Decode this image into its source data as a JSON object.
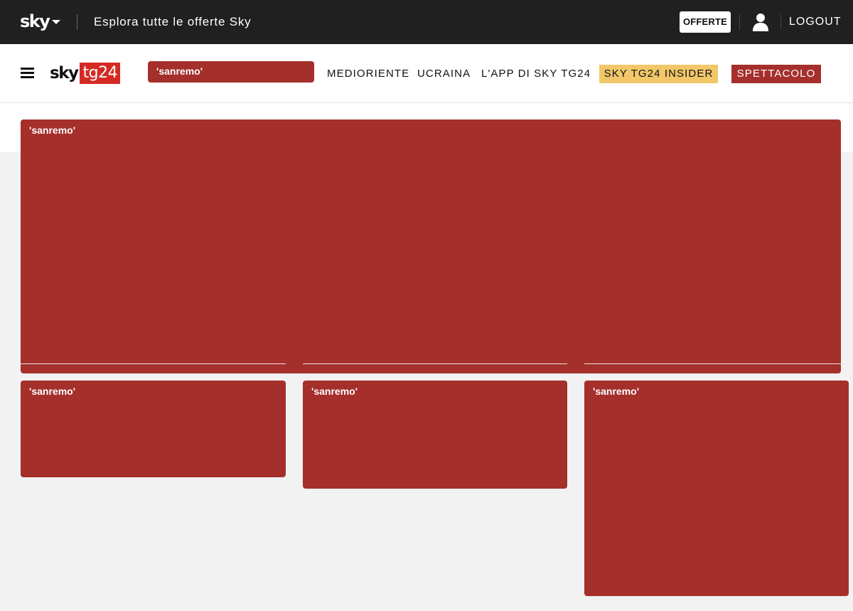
{
  "topbar": {
    "logo": "sky",
    "explore_label": "Esplora tutte le offerte Sky",
    "offers_label": "OFFERTE",
    "logout_label": "LOGOUT"
  },
  "navbar": {
    "brand_sky": "sky",
    "brand_tg24": "tg24",
    "ad_label": "'sanremo'",
    "items": [
      {
        "label": "MEDIORIENTE"
      },
      {
        "label": "UCRAINA"
      },
      {
        "label": "L'APP DI SKY TG24"
      }
    ],
    "insider_label": "SKY TG24 INSIDER",
    "spettacolo_label": "SPETTACOLO"
  },
  "ads": {
    "hero_label": "'sanremo'",
    "left_label": "'sanremo'",
    "center_label": "'sanremo'",
    "right_label": "'sanremo'"
  },
  "colors": {
    "ad_red": "#a52f2b",
    "brand_red": "#d42a23",
    "insider_yellow": "#f2c76a",
    "spettacolo_red": "#a52f2b",
    "topbar_bg": "#202020"
  }
}
